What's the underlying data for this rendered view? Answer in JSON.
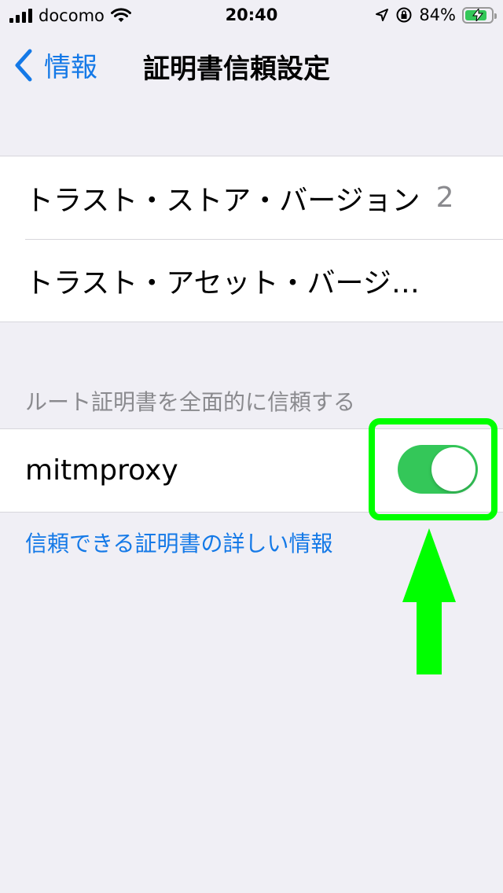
{
  "status_bar": {
    "carrier": "docomo",
    "time": "20:40",
    "battery_percent": "84%",
    "icons": [
      "signal-icon",
      "wifi-icon",
      "location-icon",
      "orientation-lock-icon",
      "battery-charging-icon"
    ]
  },
  "nav": {
    "back_label": "情報",
    "title": "証明書信頼設定"
  },
  "versions": {
    "trust_store_label": "トラスト・ストア・バージョン",
    "trust_store_value": "2",
    "trust_asset_label": "トラスト・アセット・バージ…"
  },
  "root_trust": {
    "section_header": "ルート証明書を全面的に信頼する",
    "certificates": [
      {
        "name": "mitmproxy",
        "enabled": true
      }
    ]
  },
  "footer": {
    "link_label": "信頼できる証明書の詳しい情報"
  },
  "colors": {
    "accent": "#1479e7",
    "toggle_on": "#34c759",
    "background": "#f0eff5",
    "annotation": "#00ff00"
  }
}
